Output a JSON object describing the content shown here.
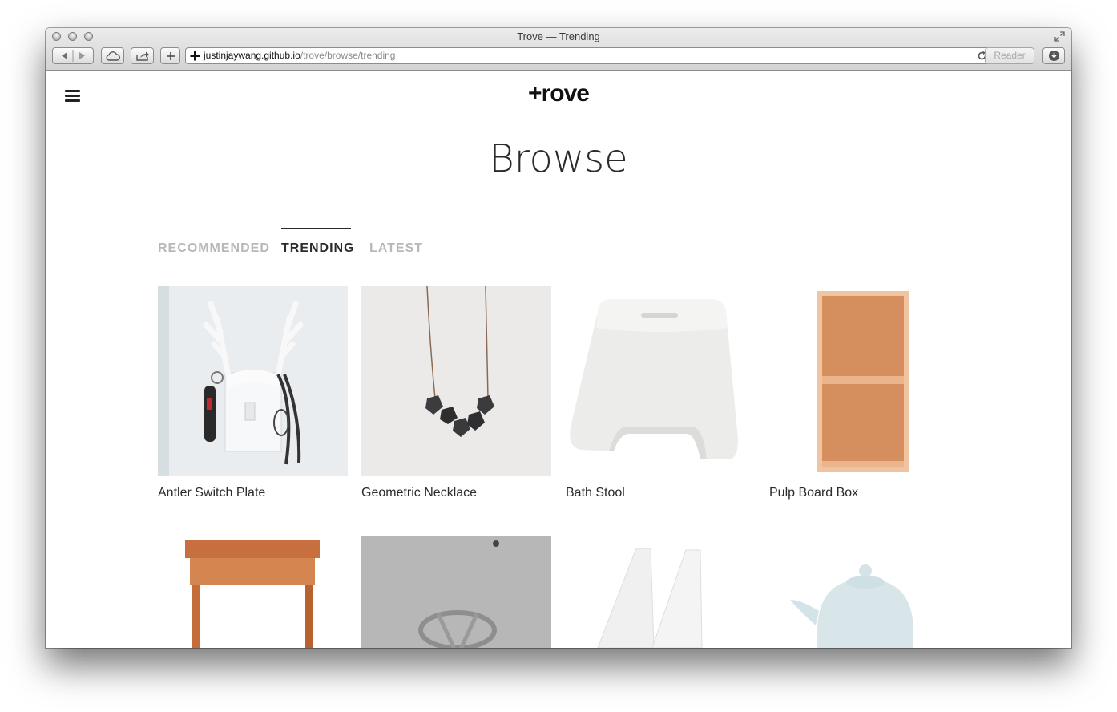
{
  "window": {
    "title": "Trove — Trending",
    "url_host": "justinjaywang.github.io",
    "url_path": "/trove/browse/trending",
    "reader_label": "Reader"
  },
  "header": {
    "logo": "+rove"
  },
  "page": {
    "title": "Browse"
  },
  "tabs": [
    {
      "label": "RECOMMENDED",
      "active": false
    },
    {
      "label": "TRENDING",
      "active": true
    },
    {
      "label": "LATEST",
      "active": false
    }
  ],
  "products": [
    {
      "name": "Antler Switch Plate",
      "image": "antler-switch-plate"
    },
    {
      "name": "Geometric Necklace",
      "image": "geometric-necklace"
    },
    {
      "name": "Bath Stool",
      "image": "bath-stool"
    },
    {
      "name": "Pulp Board Box",
      "image": "pulp-board-box"
    },
    {
      "name": "",
      "image": "wooden-side-table"
    },
    {
      "name": "",
      "image": "silver-ring"
    },
    {
      "name": "",
      "image": "file-box"
    },
    {
      "name": "",
      "image": "ceramic-teapot"
    }
  ],
  "colors": {
    "accent": "#2b2b2b",
    "inactive_tab": "#b8b8b8",
    "pulp_board": "#d79563"
  }
}
